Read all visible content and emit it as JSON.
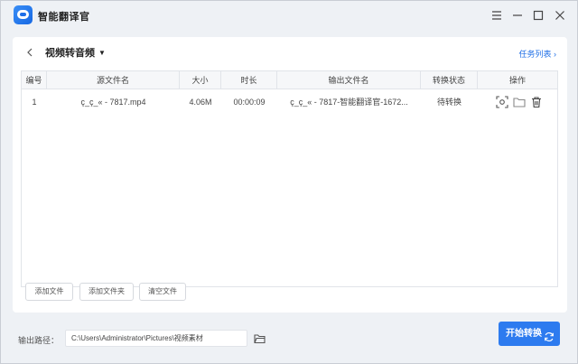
{
  "app": {
    "title": "智能翻译官"
  },
  "window_controls": {
    "menu_icon": "menu-icon",
    "minimize_icon": "minimize-icon",
    "maximize_icon": "maximize-icon",
    "close_icon": "close-icon"
  },
  "header": {
    "back_icon": "back-icon",
    "mode_label": "视频转音频",
    "task_list_label": "任务列表 ›"
  },
  "table": {
    "columns": [
      "编号",
      "源文件名",
      "大小",
      "时长",
      "输出文件名",
      "转换状态",
      "操作"
    ],
    "rows": [
      {
        "index": "1",
        "source": "ç_ç_« - 7817.mp4",
        "size": "4.06M",
        "duration": "00:00:09",
        "output": "ç_ç_« - 7817-智能翻译官-1672...",
        "status": "待转换"
      }
    ]
  },
  "buttons": {
    "add_file": "添加文件",
    "add_folder": "添加文件夹",
    "clear": "清空文件",
    "start": "开始转换"
  },
  "output": {
    "label": "输出路径：",
    "path": "C:\\Users\\Administrator\\Pictures\\视频素材"
  },
  "colors": {
    "accent": "#2d7bef",
    "link": "#1f6fe6",
    "window_bg": "#eef1f5"
  }
}
